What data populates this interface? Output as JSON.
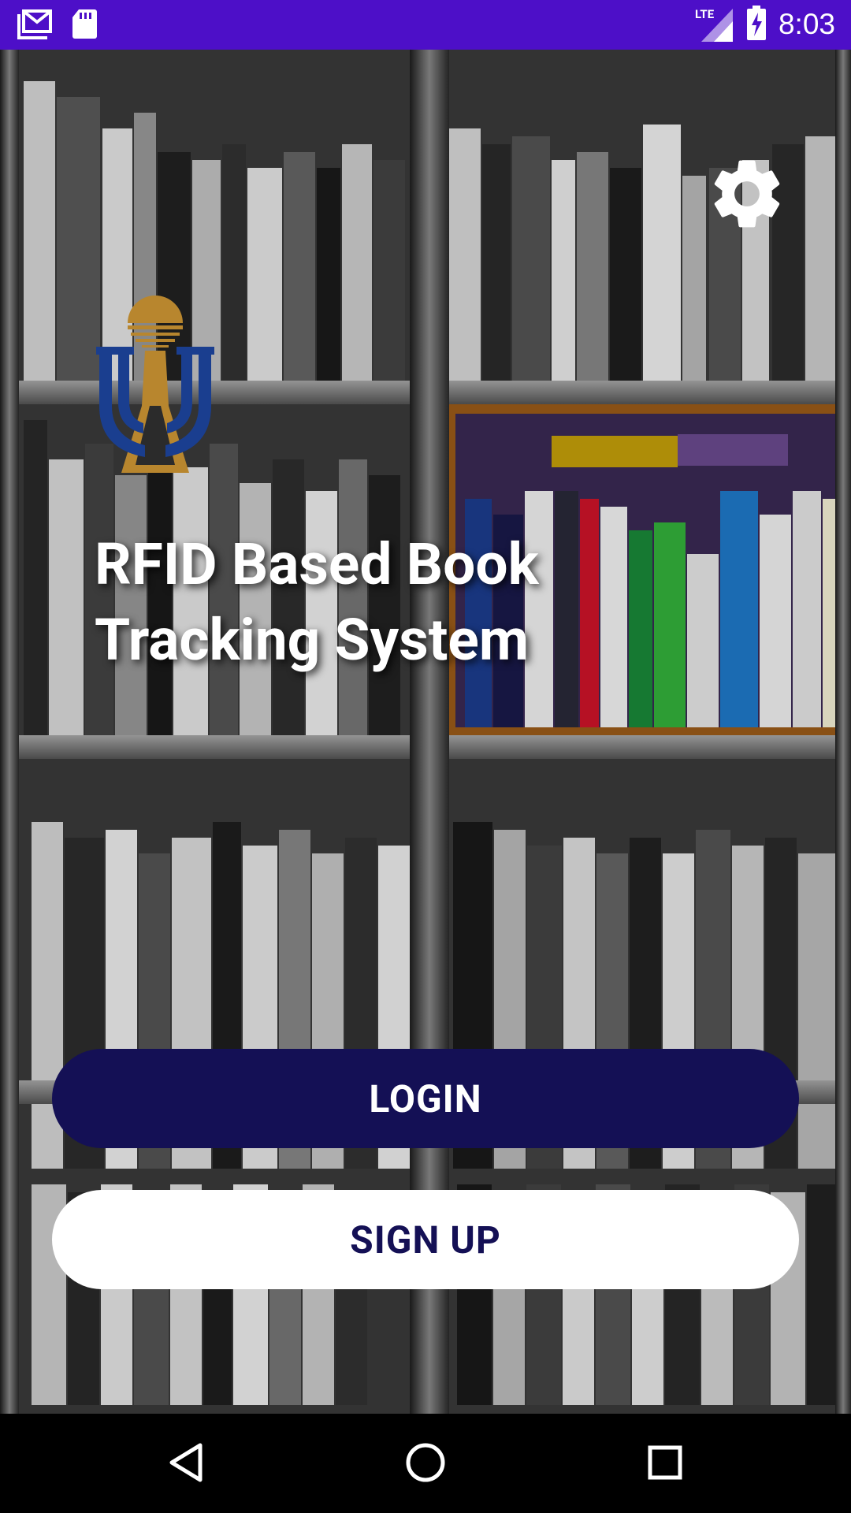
{
  "status_bar": {
    "time": "8:03",
    "network": "LTE",
    "icons": [
      "gmail-icon",
      "sd-card-icon",
      "lte-signal-icon",
      "battery-charging-icon"
    ]
  },
  "settings": {
    "icon": "gear-icon"
  },
  "logo": {
    "icon": "university-logo-icon",
    "colors": {
      "blue": "#1a3e8f",
      "gold": "#b8862e"
    }
  },
  "title": {
    "line1": "RFID Based Book",
    "line2": "Tracking System"
  },
  "actions": {
    "login_label": "LOGIN",
    "signup_label": "SIGN UP"
  },
  "nav_bar": {
    "icons": [
      "back-icon",
      "home-icon",
      "recents-icon"
    ]
  },
  "colors": {
    "status_bar": "#4d0fc8",
    "primary": "#141055",
    "accent_white": "#ffffff"
  }
}
